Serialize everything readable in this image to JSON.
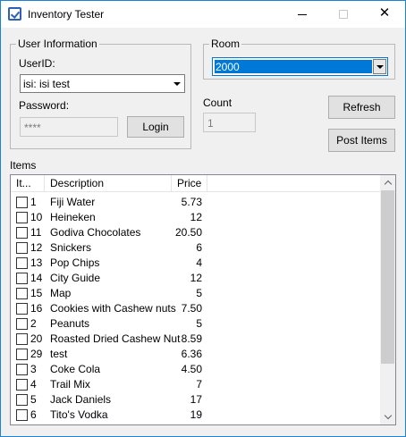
{
  "window": {
    "title": "Inventory Tester",
    "close_glyph": "✕"
  },
  "user_info": {
    "legend": "User Information",
    "userid_label": "UserID:",
    "userid_value": "isi: isi test",
    "password_label": "Password:",
    "password_value": "****",
    "login_label": "Login"
  },
  "room": {
    "legend": "Room",
    "selected": "2000"
  },
  "count": {
    "label": "Count",
    "value": "1"
  },
  "buttons": {
    "refresh": "Refresh",
    "post_items": "Post Items"
  },
  "items": {
    "label": "Items",
    "columns": [
      "It...",
      "Description",
      "Price"
    ],
    "rows": [
      {
        "item": "1",
        "description": "Fiji Water",
        "price": "5.73",
        "checked": false
      },
      {
        "item": "10",
        "description": "Heineken",
        "price": "12",
        "checked": false
      },
      {
        "item": "11",
        "description": "Godiva Chocolates",
        "price": "20.50",
        "checked": false
      },
      {
        "item": "12",
        "description": "Snickers",
        "price": "6",
        "checked": false
      },
      {
        "item": "13",
        "description": "Pop Chips",
        "price": "4",
        "checked": false
      },
      {
        "item": "14",
        "description": "City Guide",
        "price": "12",
        "checked": false
      },
      {
        "item": "15",
        "description": "Map",
        "price": "5",
        "checked": false
      },
      {
        "item": "16",
        "description": "Cookies with Cashew nuts",
        "price": "7.50",
        "checked": false
      },
      {
        "item": "2",
        "description": "Peanuts",
        "price": "5",
        "checked": false
      },
      {
        "item": "20",
        "description": "Roasted Dried Cashew Nut",
        "price": "8.59",
        "checked": false
      },
      {
        "item": "29",
        "description": "test",
        "price": "6.36",
        "checked": false
      },
      {
        "item": "3",
        "description": "Coke Cola",
        "price": "4.50",
        "checked": false
      },
      {
        "item": "4",
        "description": "Trail Mix",
        "price": "7",
        "checked": false
      },
      {
        "item": "5",
        "description": "Jack Daniels",
        "price": "17",
        "checked": false
      },
      {
        "item": "6",
        "description": "Tito's Vodka",
        "price": "19",
        "checked": false
      }
    ]
  },
  "colors": {
    "accent": "#0078d7",
    "window_border": "#1883d7",
    "background": "#f0f0f0"
  }
}
